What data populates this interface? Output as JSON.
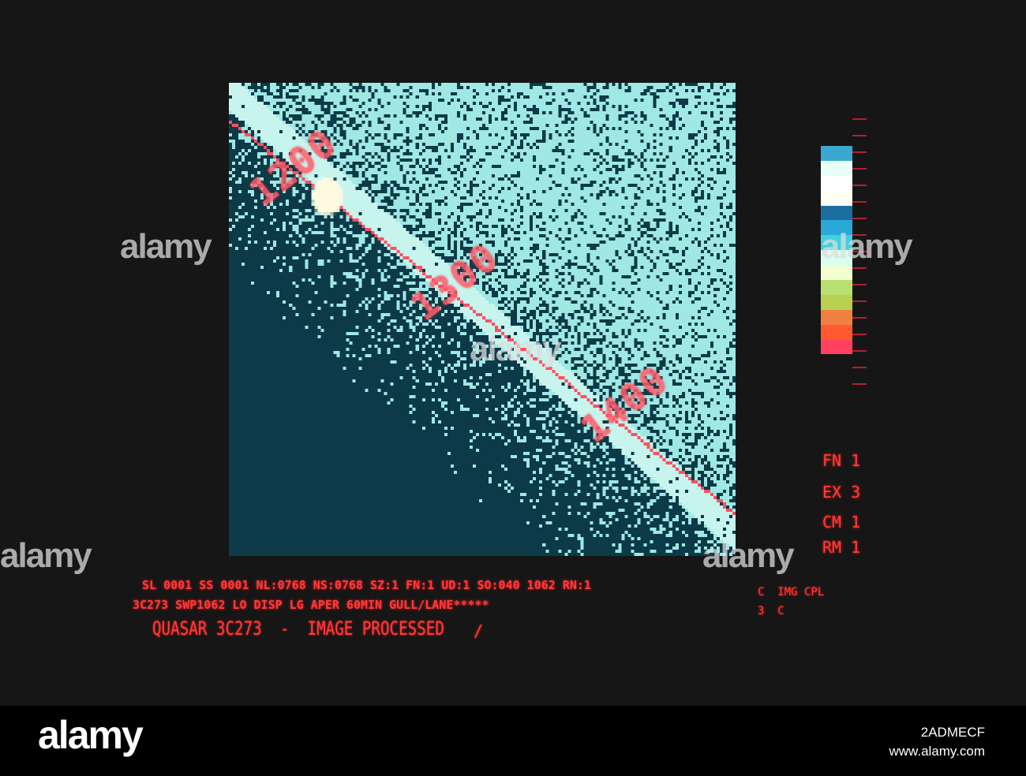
{
  "image": {
    "labels": [
      "1200",
      "1300",
      "1400"
    ],
    "colors": {
      "dark": "#0c3a48",
      "light": "#9fe8e4",
      "band": "#c8f4ee",
      "line": "#ff5060"
    }
  },
  "colorbar": {
    "segments": [
      "#3aa8d0",
      "#e8fff8",
      "#ffffff",
      "#fffff4",
      "#1c6ea0",
      "#2aa8d8",
      "#40d0e0",
      "#d8fff0",
      "#f4ffd0",
      "#b8e070",
      "#b8d050",
      "#f08040",
      "#ff5a30",
      "#ff4060"
    ]
  },
  "side_params": [
    {
      "key": "FN",
      "value": "1"
    },
    {
      "key": "EX",
      "value": "3"
    },
    {
      "key": "CM",
      "value": "1"
    },
    {
      "key": "RM",
      "value": "1"
    }
  ],
  "status": {
    "line1": "SL 0001 SS 0001 NL:0768 NS:0768 SZ:1 FN:1 UD:1 SO:040 1062 RN:1",
    "line2": "3C273 SWP1062 LO DISP LG APER 60MIN GULL/LANE*****",
    "title": "QUASAR 3C273  -  IMAGE PROCESSED",
    "slash": "/",
    "right1": "C  IMG CPL",
    "right2": "3  C"
  },
  "watermark": {
    "logo": "alamy",
    "image_id": "2ADMECF",
    "url": "www.alamy.com"
  }
}
